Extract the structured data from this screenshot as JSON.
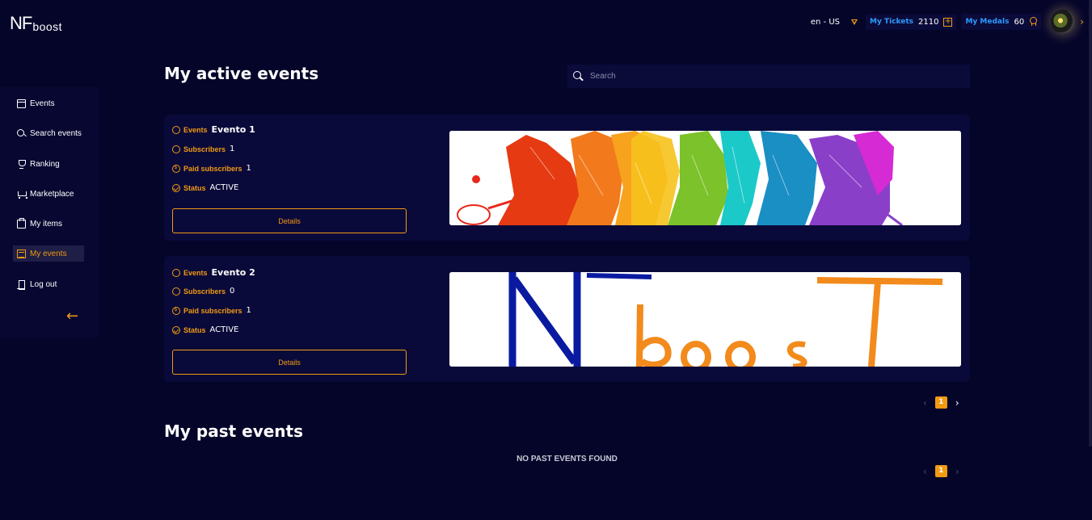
{
  "brand": {
    "logo_nf": "NF",
    "logo_boost": "boost"
  },
  "header": {
    "language": "en - US",
    "tickets_label": "My Tickets",
    "tickets_value": "2110",
    "medals_label": "My Medals",
    "medals_value": "60"
  },
  "sidebar": {
    "items": [
      {
        "label": "Events",
        "icon": "calendar-icon"
      },
      {
        "label": "Search events",
        "icon": "search-icon"
      },
      {
        "label": "Ranking",
        "icon": "trophy-icon"
      },
      {
        "label": "Marketplace",
        "icon": "cart-icon"
      },
      {
        "label": "My items",
        "icon": "briefcase-icon"
      },
      {
        "label": "My events",
        "icon": "list-icon",
        "active": true
      },
      {
        "label": "Log out",
        "icon": "logout-icon"
      }
    ],
    "collapse_glyph": "←"
  },
  "main": {
    "active_title": "My active events",
    "search_placeholder": "Search",
    "events": [
      {
        "events_label": "Events",
        "name": "Evento 1",
        "subscribers_label": "Subscribers",
        "subscribers": "1",
        "paid_label": "Paid subscribers",
        "paid": "1",
        "status_label": "Status",
        "status": "ACTIVE",
        "details_label": "Details"
      },
      {
        "events_label": "Events",
        "name": "Evento 2",
        "subscribers_label": "Subscribers",
        "subscribers": "0",
        "paid_label": "Paid subscribers",
        "paid": "1",
        "status_label": "Status",
        "status": "ACTIVE",
        "details_label": "Details"
      }
    ],
    "active_page": "1",
    "past_title": "My past events",
    "no_past_text": "NO PAST EVENTS FOUND",
    "past_page": "1"
  },
  "colors": {
    "accent": "#f29a12",
    "background": "#05052a",
    "card": "#0a0a3a",
    "link_blue": "#2d9bff"
  }
}
